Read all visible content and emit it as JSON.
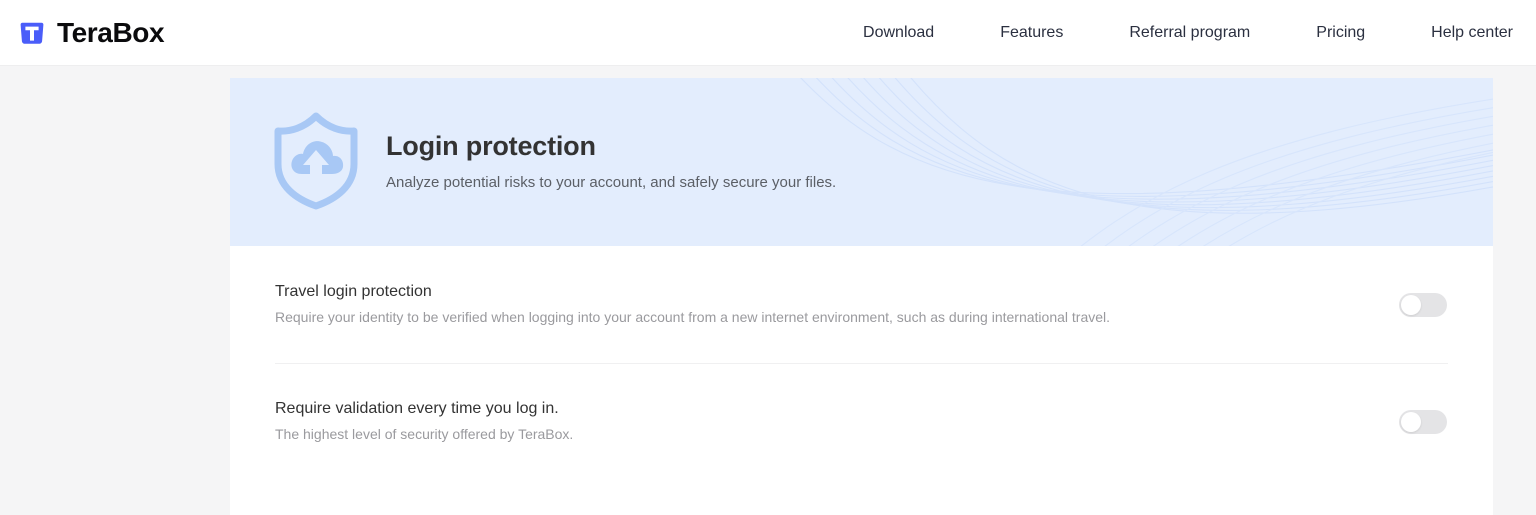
{
  "header": {
    "brand_name": "TeraBox",
    "brand_logo_icon": "terabox-box-logo-icon",
    "nav": [
      {
        "label": "Download",
        "name": "nav-item-download"
      },
      {
        "label": "Features",
        "name": "nav-item-features"
      },
      {
        "label": "Referral program",
        "name": "nav-item-referral-program"
      },
      {
        "label": "Pricing",
        "name": "nav-item-pricing"
      },
      {
        "label": "Help center",
        "name": "nav-item-help-center"
      }
    ]
  },
  "banner": {
    "icon": "shield-cloud-upload-icon",
    "title": "Login protection",
    "subtitle": "Analyze potential risks to your account, and safely secure your files.",
    "background_color": "#e3edfd"
  },
  "settings": {
    "rows": [
      {
        "title": "Travel login protection",
        "description": "Require your identity to be verified when logging into your account from a new internet environment, such as during international travel.",
        "toggle_state": "off"
      },
      {
        "title": "Require validation every time you log in.",
        "description": "The highest level of security offered by TeraBox.",
        "toggle_state": "off"
      }
    ]
  },
  "colors": {
    "brand_blue": "#4a5df9",
    "banner_bg": "#e3edfd",
    "shield_blue": "#a8c8f5",
    "page_bg": "#f5f5f6",
    "toggle_off_track": "#e4e4e6"
  }
}
